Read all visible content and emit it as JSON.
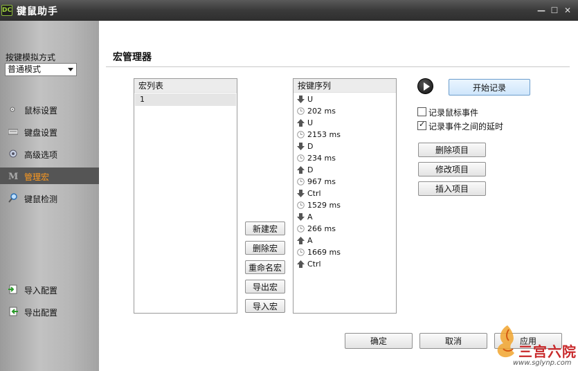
{
  "window": {
    "title": "键鼠助手",
    "logo_text": "DC",
    "controls": {
      "minimize": "—",
      "maximize": "☐",
      "close": "✕"
    }
  },
  "sidebar": {
    "mode_label": "按键模拟方式",
    "mode_value": "普通模式",
    "nav": [
      {
        "label": "鼠标设置",
        "icon": "mouse-icon"
      },
      {
        "label": "键盘设置",
        "icon": "keyboard-icon"
      },
      {
        "label": "高级选项",
        "icon": "gear-icon"
      },
      {
        "label": "管理宏",
        "icon": "macro-m-icon",
        "active": true
      },
      {
        "label": "键鼠检测",
        "icon": "magnifier-icon"
      }
    ],
    "import_label": "导入配置",
    "export_label": "导出配置"
  },
  "main": {
    "title": "宏管理器",
    "macro_list": {
      "header": "宏列表",
      "items": [
        "1"
      ]
    },
    "macro_buttons": {
      "new": "新建宏",
      "delete": "删除宏",
      "rename": "重命名宏",
      "export": "导出宏",
      "import": "导入宏"
    },
    "key_sequence": {
      "header": "按键序列",
      "items": [
        {
          "type": "down",
          "text": "U"
        },
        {
          "type": "delay",
          "text": "202 ms"
        },
        {
          "type": "up",
          "text": "U"
        },
        {
          "type": "delay",
          "text": "2153 ms"
        },
        {
          "type": "down",
          "text": "D"
        },
        {
          "type": "delay",
          "text": "234 ms"
        },
        {
          "type": "up",
          "text": "D"
        },
        {
          "type": "delay",
          "text": "967 ms"
        },
        {
          "type": "down",
          "text": "Ctrl"
        },
        {
          "type": "delay",
          "text": "1529 ms"
        },
        {
          "type": "down",
          "text": "A"
        },
        {
          "type": "delay",
          "text": "266 ms"
        },
        {
          "type": "up",
          "text": "A"
        },
        {
          "type": "delay",
          "text": "1669 ms"
        },
        {
          "type": "up",
          "text": "Ctrl"
        }
      ]
    },
    "record_button": "开始记录",
    "checkbox_mouse": {
      "label": "记录鼠标事件",
      "checked": false
    },
    "checkbox_delay": {
      "label": "记录事件之间的延时",
      "checked": true
    },
    "item_buttons": {
      "delete": "删除项目",
      "modify": "修改项目",
      "insert": "插入项目"
    },
    "footer": {
      "ok": "确定",
      "cancel": "取消",
      "apply": "应用"
    }
  },
  "watermark": {
    "text": "三宫六院",
    "url": "www.sglynp.com"
  }
}
